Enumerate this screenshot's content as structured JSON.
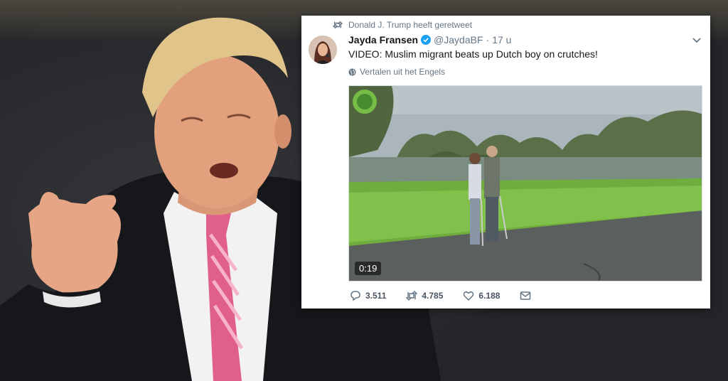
{
  "retweet_notice": "Donald J. Trump heeft geretweet",
  "tweet": {
    "author_name": "Jayda Fransen",
    "author_handle": "@JaydaBF",
    "separator": "·",
    "time": "17 u",
    "text": "VIDEO: Muslim migrant beats up Dutch boy on crutches!",
    "translate_link": "Vertalen uit het Engels",
    "video_duration": "0:19"
  },
  "actions": {
    "replies": "3.511",
    "retweets": "4.785",
    "likes": "6.188"
  },
  "icons": {
    "retweet": "retweet-icon",
    "verified": "verified-badge-icon",
    "caret": "chevron-down-icon",
    "globe": "globe-icon",
    "reply": "reply-icon",
    "like": "heart-icon",
    "dm": "envelope-icon"
  },
  "colors": {
    "verified_blue": "#1da1f2",
    "muted_text": "#657786",
    "tie_pink": "#e0608a"
  }
}
